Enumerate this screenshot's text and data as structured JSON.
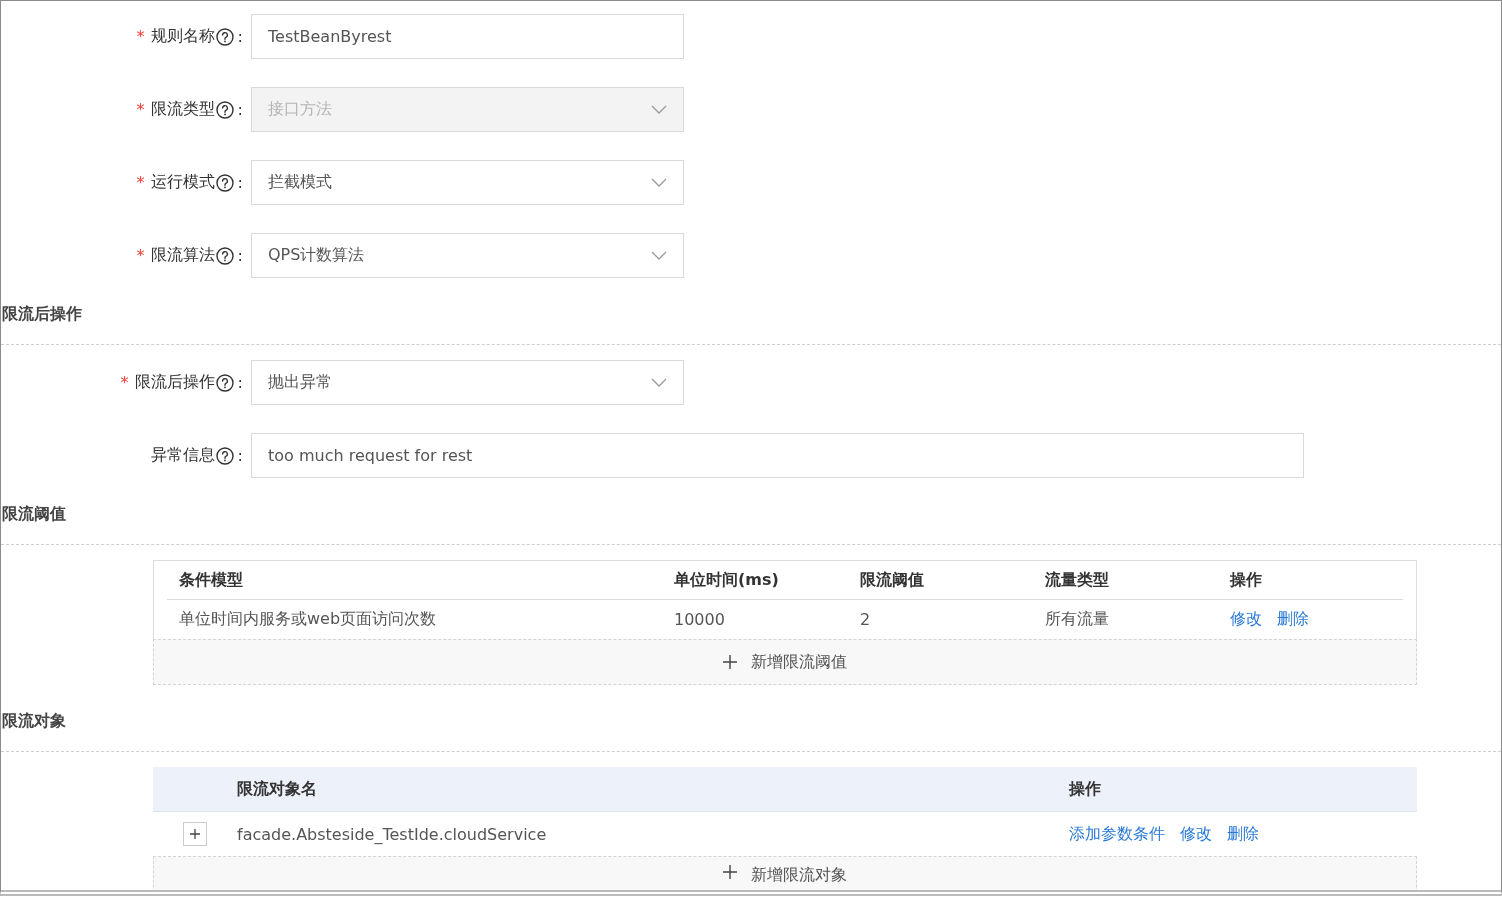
{
  "fields": [
    {
      "required_mark": "*",
      "label": "规则名称",
      "help": true,
      "colon": ":",
      "kind": "input",
      "value": "TestBeanByrest",
      "disabled": false,
      "wide": false
    },
    {
      "required_mark": "*",
      "label": "限流类型",
      "help": true,
      "colon": ":",
      "kind": "select",
      "value": "接口方法",
      "disabled": true,
      "wide": false
    },
    {
      "required_mark": "*",
      "label": "运行模式",
      "help": true,
      "colon": ":",
      "kind": "select",
      "value": "拦截模式",
      "disabled": false,
      "wide": false
    },
    {
      "required_mark": "*",
      "label": "限流算法",
      "help": true,
      "colon": ":",
      "kind": "select",
      "value": "QPS计数算法",
      "disabled": false,
      "wide": false
    }
  ],
  "sections": [
    {
      "title": "限流后操作",
      "fields": [
        {
          "required_mark": "*",
          "label": "限流后操作",
          "help": true,
          "colon": ":",
          "kind": "select",
          "value": "抛出异常",
          "disabled": false,
          "wide": false
        },
        {
          "label": "异常信息",
          "help": true,
          "colon": ":",
          "kind": "input",
          "value": "too much request for rest",
          "disabled": false,
          "wide": true
        }
      ]
    },
    {
      "title": "限流阈值",
      "table": {
        "kind": "bordered",
        "columns": [
          "条件模型",
          "单位时间(ms)",
          "限流阈值",
          "流量类型",
          "操作"
        ],
        "rows": [
          {
            "cells": [
              "单位时间内服务或web页面访问次数",
              "10000",
              "2",
              "所有流量"
            ],
            "actions": [
              "修改",
              "删除"
            ]
          }
        ],
        "add_button": "新增限流阈值"
      }
    },
    {
      "title": "限流对象",
      "table": {
        "kind": "shaded",
        "columns": [
          "限流对象名",
          "操作"
        ],
        "rows": [
          {
            "expanded": false,
            "cells": [
              "facade.Absteside_TestIde.cloudService"
            ],
            "actions": [
              "添加参数条件",
              "修改",
              "删除"
            ]
          }
        ],
        "add_button": "新增限流对象"
      }
    }
  ]
}
